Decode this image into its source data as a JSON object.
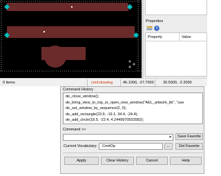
{
  "colors": {
    "canvas_background": "#000000",
    "shape_fill": "#6b2b2b",
    "selection_handle": "#00c0c0",
    "dotted_line": "#ffffff",
    "status_command": "#cc3300"
  },
  "properties": {
    "title": "Properties",
    "toolbar_icons": [
      "sort-icon",
      "help-icon"
    ],
    "columns": [
      "Property",
      "Value"
    ]
  },
  "status": {
    "items": "0 items",
    "command": "cmd:drawing",
    "cursor": "46.1000, -27.7000",
    "coords": "30.5000, -2.2000"
  },
  "command_history": {
    "title": "Command History",
    "lines": [
      "de_close_window();",
      "de_bring_view_to_top_or_open_new_window(\"AEL_artwork_lib\", \"use",
      "de_set_window_by_sequence(2, 0);",
      "de_add_rectangle(23.9, -19.1, 34.4, -24.4);",
      "de_add_circle(18.5, -22.4, 4.2449970553582);"
    ]
  },
  "command": {
    "label": "Command >>",
    "value": "",
    "save_favorite": "Save Favorite",
    "del_favorite": "Del Favorite"
  },
  "vocabulary": {
    "label": "Current Vocabulary:",
    "value": "CmdOp",
    "browse": "..."
  },
  "buttons": {
    "apply": "Apply",
    "clear_history": "Clear History",
    "cancel": "Cancel",
    "help": "Help"
  }
}
